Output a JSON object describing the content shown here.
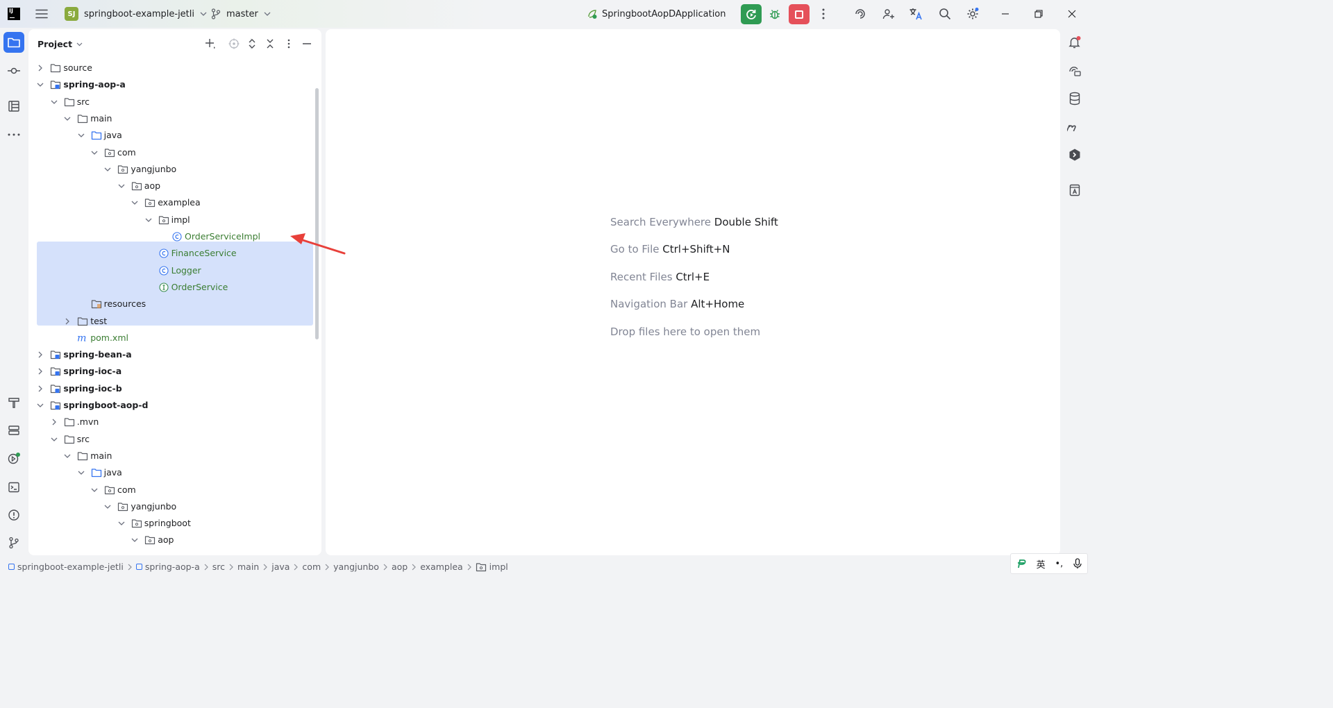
{
  "titlebar": {
    "project_badge": "SJ",
    "project_name": "springboot-example-jetli",
    "branch": "master",
    "run_config": "SpringbootAopDApplication"
  },
  "project_panel": {
    "title": "Project"
  },
  "tree": [
    {
      "label": "source",
      "depth": 1,
      "chev": "right",
      "icon": "folder",
      "style": ""
    },
    {
      "label": "spring-aop-a",
      "depth": 1,
      "chev": "down",
      "icon": "module",
      "style": "bold"
    },
    {
      "label": "src",
      "depth": 2,
      "chev": "down",
      "icon": "folder",
      "style": ""
    },
    {
      "label": "main",
      "depth": 3,
      "chev": "down",
      "icon": "folder",
      "style": ""
    },
    {
      "label": "java",
      "depth": 4,
      "chev": "down",
      "icon": "source-folder",
      "style": ""
    },
    {
      "label": "com",
      "depth": 5,
      "chev": "down",
      "icon": "package",
      "style": ""
    },
    {
      "label": "yangjunbo",
      "depth": 6,
      "chev": "down",
      "icon": "package",
      "style": ""
    },
    {
      "label": "aop",
      "depth": 7,
      "chev": "down",
      "icon": "package",
      "style": ""
    },
    {
      "label": "examplea",
      "depth": 8,
      "chev": "down",
      "icon": "package",
      "style": ""
    },
    {
      "label": "impl",
      "depth": 9,
      "chev": "down",
      "icon": "package",
      "style": ""
    },
    {
      "label": "OrderServiceImpl",
      "depth": 10,
      "chev": "",
      "icon": "class",
      "style": "green"
    },
    {
      "label": "FinanceService",
      "depth": 9,
      "chev": "",
      "icon": "class",
      "style": "green"
    },
    {
      "label": "Logger",
      "depth": 9,
      "chev": "",
      "icon": "class",
      "style": "green"
    },
    {
      "label": "OrderService",
      "depth": 9,
      "chev": "",
      "icon": "interface",
      "style": "green"
    },
    {
      "label": "resources",
      "depth": 4,
      "chev": "",
      "icon": "resources",
      "style": ""
    },
    {
      "label": "test",
      "depth": 3,
      "chev": "right",
      "icon": "folder",
      "style": ""
    },
    {
      "label": "pom.xml",
      "depth": 3,
      "chev": "",
      "icon": "maven",
      "style": "green"
    },
    {
      "label": "spring-bean-a",
      "depth": 1,
      "chev": "right",
      "icon": "module",
      "style": "bold"
    },
    {
      "label": "spring-ioc-a",
      "depth": 1,
      "chev": "right",
      "icon": "module",
      "style": "bold"
    },
    {
      "label": "spring-ioc-b",
      "depth": 1,
      "chev": "right",
      "icon": "module",
      "style": "bold"
    },
    {
      "label": "springboot-aop-d",
      "depth": 1,
      "chev": "down",
      "icon": "module",
      "style": "bold"
    },
    {
      "label": ".mvn",
      "depth": 2,
      "chev": "right",
      "icon": "folder",
      "style": ""
    },
    {
      "label": "src",
      "depth": 2,
      "chev": "down",
      "icon": "folder",
      "style": ""
    },
    {
      "label": "main",
      "depth": 3,
      "chev": "down",
      "icon": "folder",
      "style": ""
    },
    {
      "label": "java",
      "depth": 4,
      "chev": "down",
      "icon": "source-folder",
      "style": ""
    },
    {
      "label": "com",
      "depth": 5,
      "chev": "down",
      "icon": "package",
      "style": ""
    },
    {
      "label": "yangjunbo",
      "depth": 6,
      "chev": "down",
      "icon": "package",
      "style": ""
    },
    {
      "label": "springboot",
      "depth": 7,
      "chev": "down",
      "icon": "package",
      "style": ""
    },
    {
      "label": "aop",
      "depth": 8,
      "chev": "down",
      "icon": "package",
      "style": ""
    }
  ],
  "editor": {
    "hints": [
      {
        "text": "Search Everywhere",
        "shortcut": "Double Shift"
      },
      {
        "text": "Go to File",
        "shortcut": "Ctrl+Shift+N"
      },
      {
        "text": "Recent Files",
        "shortcut": "Ctrl+E"
      },
      {
        "text": "Navigation Bar",
        "shortcut": "Alt+Home"
      },
      {
        "text": "Drop files here to open them",
        "shortcut": ""
      }
    ]
  },
  "breadcrumbs": [
    {
      "label": "springboot-example-jetli",
      "icon": "module"
    },
    {
      "label": "spring-aop-a",
      "icon": "module"
    },
    {
      "label": "src",
      "icon": ""
    },
    {
      "label": "main",
      "icon": ""
    },
    {
      "label": "java",
      "icon": ""
    },
    {
      "label": "com",
      "icon": ""
    },
    {
      "label": "yangjunbo",
      "icon": ""
    },
    {
      "label": "aop",
      "icon": ""
    },
    {
      "label": "examplea",
      "icon": ""
    },
    {
      "label": "impl",
      "icon": "package"
    }
  ],
  "ime": {
    "lang": "英",
    "punct": "•,"
  },
  "colors": {
    "accent": "#3574f0",
    "run": "#2f9b53",
    "stop": "#e5505a",
    "selection": "#d5e1fb",
    "arrow": "#e8403a"
  }
}
